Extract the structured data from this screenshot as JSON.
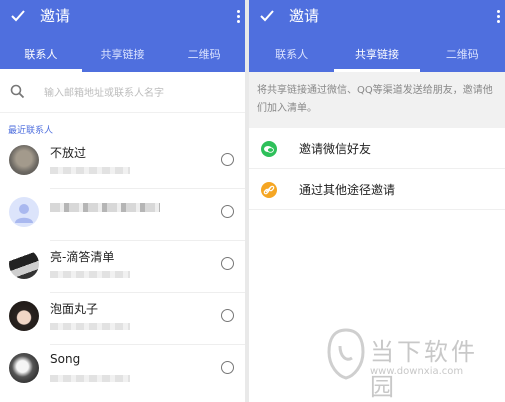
{
  "left": {
    "title": "邀请",
    "tabs": [
      "联系人",
      "共享链接",
      "二维码"
    ],
    "active_tab": 0,
    "search_placeholder": "输入邮箱地址或联系人名字",
    "section": "最近联系人",
    "contacts": [
      {
        "name": "不放过"
      },
      {
        "name": ""
      },
      {
        "name": "亮-滴答清单"
      },
      {
        "name": "泡面丸子"
      },
      {
        "name": "Song"
      }
    ]
  },
  "right": {
    "title": "邀请",
    "tabs": [
      "联系人",
      "共享链接",
      "二维码"
    ],
    "active_tab": 1,
    "info": "将共享链接通过微信、QQ等渠道发送给朋友，邀请他们加入清单。",
    "actions": [
      {
        "label": "邀请微信好友",
        "icon": "wechat-icon",
        "color": "#2ec05a"
      },
      {
        "label": "通过其他途径邀请",
        "icon": "link-icon",
        "color": "#f5a623"
      }
    ]
  },
  "colors": {
    "accent": "#4f6fde"
  },
  "watermark": {
    "brand": "当下软件园",
    "url": "www.downxia.com"
  }
}
